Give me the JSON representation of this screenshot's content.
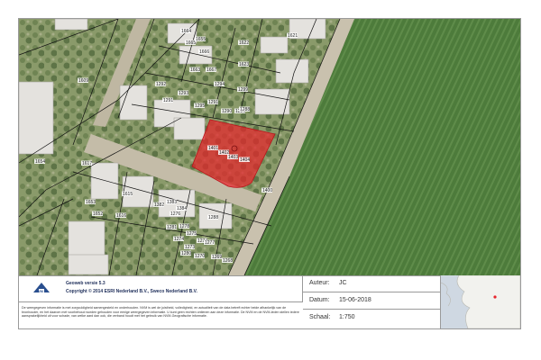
{
  "map": {
    "highlight_color": "#e8242b",
    "field_color": "#4f7a3c",
    "parcel_labels": [
      "1664",
      "1665",
      "1655",
      "1666",
      "1663",
      "1667",
      "1622",
      "1621",
      "1623",
      "1609",
      "1292",
      "1293",
      "1294",
      "1291",
      "1290",
      "1299",
      "1291",
      "1295",
      "1296",
      "1401",
      "1402",
      "1403",
      "1404",
      "1276",
      "1278",
      "1281",
      "1275",
      "1274",
      "1273",
      "1288",
      "1274",
      "1277",
      "1280",
      "1382",
      "1383",
      "1384",
      "1270",
      "1269",
      "1268",
      "1654",
      "1653",
      "1652",
      "1617",
      "1616",
      "1615",
      "1400",
      "1288"
    ]
  },
  "footer": {
    "logo_text": "NVM",
    "version": "Geoweb versie 5.3",
    "copyright": "Copyright © 2014 ESRI Nederland B.V., Sweco Nederland B.V.",
    "disclaimer": "De weergegeven informatie is met zorgvuldigheid samengesteld en onderhouden. NVM is wel de juistheid, volledigheid, en actualiteit van de data betreft echter beide afhankelijk van de bronhouder, en het daarom met voorbehoud worden gehouden voor eenige weergegeven informatie. U kunt geen rechten ontlenen aan deze informatie. De NVM en de NVM-leden stellen iedere aansprakelijkheid uit voor schade, van welke aard dan ook, die verband houdt met het gebruik van NVM-Geografische informatie.",
    "fields": [
      {
        "label": "Auteur:",
        "value": "JC"
      },
      {
        "label": "Datum:",
        "value": "15-06-2018"
      },
      {
        "label": "Schaal:",
        "value": "1:750"
      }
    ]
  }
}
